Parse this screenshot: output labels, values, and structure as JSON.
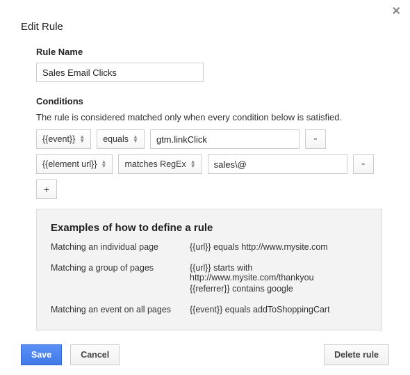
{
  "dialog": {
    "title": "Edit Rule",
    "close_glyph": "×"
  },
  "ruleName": {
    "label": "Rule Name",
    "value": "Sales Email Clicks"
  },
  "conditions": {
    "label": "Conditions",
    "help": "The rule is considered matched only when every condition below is satisfied.",
    "rows": [
      {
        "variable": "{{event}}",
        "operator": "equals",
        "value": "gtm.linkClick",
        "remove": "-"
      },
      {
        "variable": "{{element url}}",
        "operator": "matches RegEx",
        "value": "sales\\@",
        "remove": "-"
      }
    ],
    "add": "+"
  },
  "examples": {
    "title": "Examples of how to define a rule",
    "rows": [
      {
        "label": "Matching an individual page",
        "lines": [
          "{{url}} equals http://www.mysite.com"
        ]
      },
      {
        "label": "Matching a group of pages",
        "lines": [
          "{{url}} starts with http://www.mysite.com/thankyou",
          "{{referrer}} contains google"
        ]
      },
      {
        "label": "Matching an event on all pages",
        "lines": [
          "{{event}} equals addToShoppingCart"
        ]
      }
    ]
  },
  "footer": {
    "save": "Save",
    "cancel": "Cancel",
    "delete": "Delete rule"
  }
}
